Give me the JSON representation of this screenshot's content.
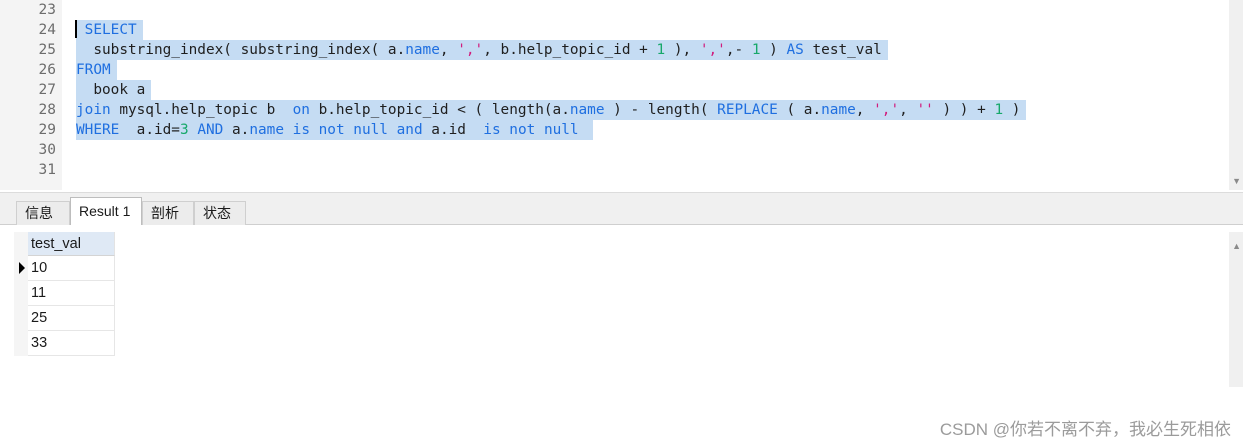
{
  "editor": {
    "line_numbers": [
      "23",
      "24",
      "25",
      "26",
      "27",
      "28",
      "29",
      "30",
      "31"
    ],
    "lines": [
      {
        "tokens": []
      },
      {
        "tokens": [
          {
            "t": " "
          },
          {
            "t": "SELECT",
            "c": "kw"
          }
        ]
      },
      {
        "tokens": [
          {
            "t": "  substring_index( substring_index( a."
          },
          {
            "t": "name",
            "c": "kw"
          },
          {
            "t": ", "
          },
          {
            "t": "','",
            "c": "str"
          },
          {
            "t": ", b.help_topic_id + "
          },
          {
            "t": "1",
            "c": "num"
          },
          {
            "t": " ), "
          },
          {
            "t": "','",
            "c": "str"
          },
          {
            "t": ",- "
          },
          {
            "t": "1",
            "c": "num"
          },
          {
            "t": " ) "
          },
          {
            "t": "AS",
            "c": "kw"
          },
          {
            "t": " test_val"
          }
        ]
      },
      {
        "tokens": [
          {
            "t": "FROM",
            "c": "kw"
          }
        ]
      },
      {
        "tokens": [
          {
            "t": "  book a"
          }
        ]
      },
      {
        "tokens": [
          {
            "t": "join",
            "c": "kw"
          },
          {
            "t": " mysql.help_topic b  "
          },
          {
            "t": "on",
            "c": "kw"
          },
          {
            "t": " b.help_topic_id < ( length(a."
          },
          {
            "t": "name",
            "c": "kw"
          },
          {
            "t": " ) - length( "
          },
          {
            "t": "REPLACE",
            "c": "fn"
          },
          {
            "t": " ( a."
          },
          {
            "t": "name",
            "c": "kw"
          },
          {
            "t": ", "
          },
          {
            "t": "','",
            "c": "str"
          },
          {
            "t": ", "
          },
          {
            "t": "''",
            "c": "str"
          },
          {
            "t": " ) ) + "
          },
          {
            "t": "1",
            "c": "num"
          },
          {
            "t": " )"
          }
        ]
      },
      {
        "tokens": [
          {
            "t": "WHERE",
            "c": "kw"
          },
          {
            "t": "  a.id="
          },
          {
            "t": "3",
            "c": "num"
          },
          {
            "t": " "
          },
          {
            "t": "AND",
            "c": "kw"
          },
          {
            "t": " a."
          },
          {
            "t": "name",
            "c": "kw"
          },
          {
            "t": " "
          },
          {
            "t": "is not null",
            "c": "kw"
          },
          {
            "t": " "
          },
          {
            "t": "and",
            "c": "kw"
          },
          {
            "t": " a.id  "
          },
          {
            "t": "is not null",
            "c": "kw"
          },
          {
            "t": " "
          }
        ]
      },
      {
        "tokens": []
      },
      {
        "tokens": []
      }
    ],
    "selected_lines": [
      1,
      2,
      3,
      4,
      5,
      6
    ],
    "colors": {
      "keyword": "#1f6fe0",
      "string": "#d11c7d",
      "number": "#17a86a",
      "selection": "#c5dcf3",
      "gutter_bg": "#f4f4f4"
    }
  },
  "tabs": [
    {
      "label": "信息",
      "active": false
    },
    {
      "label": "Result 1",
      "active": true
    },
    {
      "label": "剖析",
      "active": false
    },
    {
      "label": "状态",
      "active": false
    }
  ],
  "results": {
    "columns": [
      "test_val"
    ],
    "rows": [
      [
        "10"
      ],
      [
        "11"
      ],
      [
        "25"
      ],
      [
        "33"
      ]
    ],
    "current_row": 0
  },
  "watermark": "CSDN @你若不离不弃，我必生死相依"
}
